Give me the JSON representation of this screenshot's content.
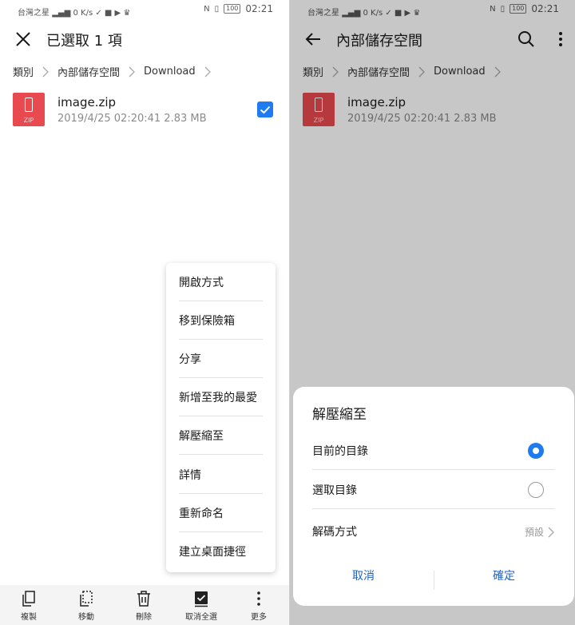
{
  "colors": {
    "accent": "#1e7cf0",
    "zip_red": "#e84a4f",
    "dialog_button": "#1e63c4"
  },
  "status": {
    "carrier": "台灣之星",
    "speed_value": "0",
    "speed_unit": "K/s",
    "battery": "100",
    "time": "02:21"
  },
  "left": {
    "title": "已選取 1 項",
    "breadcrumb": [
      "類別",
      "內部儲存空間",
      "Download"
    ],
    "file": {
      "name": "image.zip",
      "meta": "2019/4/25 02:20:41 2.83 MB",
      "badge": "ZIP",
      "selected": true
    },
    "menu": [
      "開啟方式",
      "移到保險箱",
      "分享",
      "新增至我的最愛",
      "解壓縮至",
      "詳情",
      "重新命名",
      "建立桌面捷徑"
    ],
    "toolbar": [
      {
        "label": "複製",
        "icon": "copy-icon"
      },
      {
        "label": "移動",
        "icon": "move-icon"
      },
      {
        "label": "刪除",
        "icon": "trash-icon"
      },
      {
        "label": "取消全選",
        "icon": "select-all-icon"
      },
      {
        "label": "更多",
        "icon": "more-icon"
      }
    ]
  },
  "right": {
    "title": "內部儲存空間",
    "breadcrumb": [
      "類別",
      "內部儲存空間",
      "Download"
    ],
    "file": {
      "name": "image.zip",
      "meta": "2019/4/25 02:20:41 2.83 MB",
      "badge": "ZIP"
    },
    "dialog": {
      "title": "解壓縮至",
      "options": [
        {
          "label": "目前的目錄",
          "selected": true
        },
        {
          "label": "選取目錄",
          "selected": false
        }
      ],
      "encoding_label": "解碼方式",
      "encoding_value": "預設",
      "cancel": "取消",
      "confirm": "確定"
    }
  }
}
